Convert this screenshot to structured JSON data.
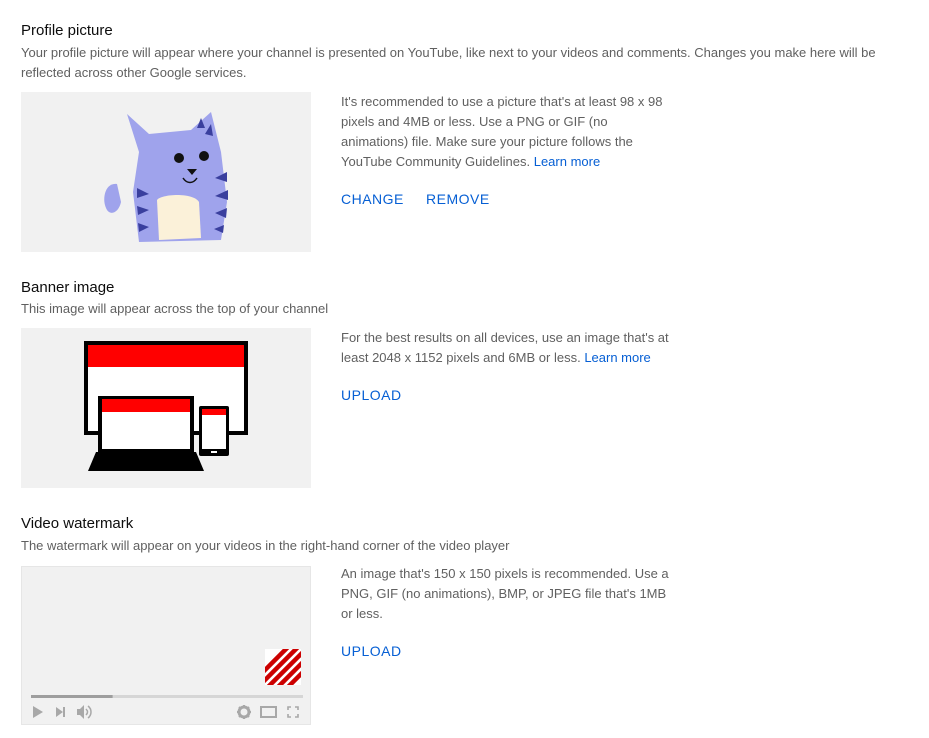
{
  "profile": {
    "title": "Profile picture",
    "description": "Your profile picture will appear where your channel is presented on YouTube, like next to your videos and comments. Changes you make here will be reflected across other Google services.",
    "info": "It's recommended to use a picture that's at least 98 x 98 pixels and 4MB or less. Use a PNG or GIF (no animations) file. Make sure your picture follows the YouTube Community Guidelines.",
    "learn_more": "Learn more",
    "change_label": "CHANGE",
    "remove_label": "REMOVE"
  },
  "banner": {
    "title": "Banner image",
    "description": "This image will appear across the top of your channel",
    "info": "For the best results on all devices, use an image that's at least 2048 x 1152 pixels and 6MB or less.",
    "learn_more": "Learn more",
    "upload_label": "UPLOAD"
  },
  "watermark": {
    "title": "Video watermark",
    "description": "The watermark will appear on your videos in the right-hand corner of the video player",
    "info": "An image that's 150 x 150 pixels is recommended. Use a PNG, GIF (no animations), BMP, or JPEG file that's 1MB or less.",
    "upload_label": "UPLOAD",
    "player_progress": 0.3
  },
  "colors": {
    "accent": "#065fd4",
    "cat": "#9fa3ec",
    "banner_red": "#ff0000",
    "watermark_red": "#cc0000"
  },
  "icons": [
    "cat-avatar-illustration",
    "devices-illustration",
    "play-icon",
    "next-icon",
    "volume-icon",
    "settings-icon",
    "theater-icon",
    "fullscreen-icon"
  ]
}
